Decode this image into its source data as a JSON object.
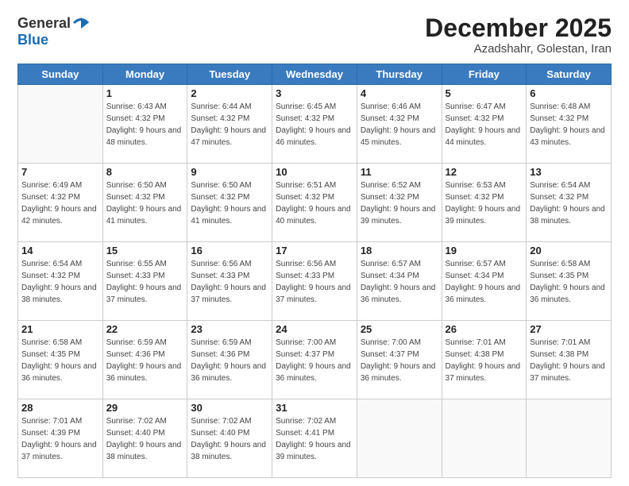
{
  "logo": {
    "general": "General",
    "blue": "Blue"
  },
  "title": {
    "month": "December 2025",
    "location": "Azadshahr, Golestan, Iran"
  },
  "weekdays": [
    "Sunday",
    "Monday",
    "Tuesday",
    "Wednesday",
    "Thursday",
    "Friday",
    "Saturday"
  ],
  "weeks": [
    [
      {
        "day": "",
        "sunrise": "",
        "sunset": "",
        "daylight": ""
      },
      {
        "day": "1",
        "sunrise": "Sunrise: 6:43 AM",
        "sunset": "Sunset: 4:32 PM",
        "daylight": "Daylight: 9 hours and 48 minutes."
      },
      {
        "day": "2",
        "sunrise": "Sunrise: 6:44 AM",
        "sunset": "Sunset: 4:32 PM",
        "daylight": "Daylight: 9 hours and 47 minutes."
      },
      {
        "day": "3",
        "sunrise": "Sunrise: 6:45 AM",
        "sunset": "Sunset: 4:32 PM",
        "daylight": "Daylight: 9 hours and 46 minutes."
      },
      {
        "day": "4",
        "sunrise": "Sunrise: 6:46 AM",
        "sunset": "Sunset: 4:32 PM",
        "daylight": "Daylight: 9 hours and 45 minutes."
      },
      {
        "day": "5",
        "sunrise": "Sunrise: 6:47 AM",
        "sunset": "Sunset: 4:32 PM",
        "daylight": "Daylight: 9 hours and 44 minutes."
      },
      {
        "day": "6",
        "sunrise": "Sunrise: 6:48 AM",
        "sunset": "Sunset: 4:32 PM",
        "daylight": "Daylight: 9 hours and 43 minutes."
      }
    ],
    [
      {
        "day": "7",
        "sunrise": "Sunrise: 6:49 AM",
        "sunset": "Sunset: 4:32 PM",
        "daylight": "Daylight: 9 hours and 42 minutes."
      },
      {
        "day": "8",
        "sunrise": "Sunrise: 6:50 AM",
        "sunset": "Sunset: 4:32 PM",
        "daylight": "Daylight: 9 hours and 41 minutes."
      },
      {
        "day": "9",
        "sunrise": "Sunrise: 6:50 AM",
        "sunset": "Sunset: 4:32 PM",
        "daylight": "Daylight: 9 hours and 41 minutes."
      },
      {
        "day": "10",
        "sunrise": "Sunrise: 6:51 AM",
        "sunset": "Sunset: 4:32 PM",
        "daylight": "Daylight: 9 hours and 40 minutes."
      },
      {
        "day": "11",
        "sunrise": "Sunrise: 6:52 AM",
        "sunset": "Sunset: 4:32 PM",
        "daylight": "Daylight: 9 hours and 39 minutes."
      },
      {
        "day": "12",
        "sunrise": "Sunrise: 6:53 AM",
        "sunset": "Sunset: 4:32 PM",
        "daylight": "Daylight: 9 hours and 39 minutes."
      },
      {
        "day": "13",
        "sunrise": "Sunrise: 6:54 AM",
        "sunset": "Sunset: 4:32 PM",
        "daylight": "Daylight: 9 hours and 38 minutes."
      }
    ],
    [
      {
        "day": "14",
        "sunrise": "Sunrise: 6:54 AM",
        "sunset": "Sunset: 4:32 PM",
        "daylight": "Daylight: 9 hours and 38 minutes."
      },
      {
        "day": "15",
        "sunrise": "Sunrise: 6:55 AM",
        "sunset": "Sunset: 4:33 PM",
        "daylight": "Daylight: 9 hours and 37 minutes."
      },
      {
        "day": "16",
        "sunrise": "Sunrise: 6:56 AM",
        "sunset": "Sunset: 4:33 PM",
        "daylight": "Daylight: 9 hours and 37 minutes."
      },
      {
        "day": "17",
        "sunrise": "Sunrise: 6:56 AM",
        "sunset": "Sunset: 4:33 PM",
        "daylight": "Daylight: 9 hours and 37 minutes."
      },
      {
        "day": "18",
        "sunrise": "Sunrise: 6:57 AM",
        "sunset": "Sunset: 4:34 PM",
        "daylight": "Daylight: 9 hours and 36 minutes."
      },
      {
        "day": "19",
        "sunrise": "Sunrise: 6:57 AM",
        "sunset": "Sunset: 4:34 PM",
        "daylight": "Daylight: 9 hours and 36 minutes."
      },
      {
        "day": "20",
        "sunrise": "Sunrise: 6:58 AM",
        "sunset": "Sunset: 4:35 PM",
        "daylight": "Daylight: 9 hours and 36 minutes."
      }
    ],
    [
      {
        "day": "21",
        "sunrise": "Sunrise: 6:58 AM",
        "sunset": "Sunset: 4:35 PM",
        "daylight": "Daylight: 9 hours and 36 minutes."
      },
      {
        "day": "22",
        "sunrise": "Sunrise: 6:59 AM",
        "sunset": "Sunset: 4:36 PM",
        "daylight": "Daylight: 9 hours and 36 minutes."
      },
      {
        "day": "23",
        "sunrise": "Sunrise: 6:59 AM",
        "sunset": "Sunset: 4:36 PM",
        "daylight": "Daylight: 9 hours and 36 minutes."
      },
      {
        "day": "24",
        "sunrise": "Sunrise: 7:00 AM",
        "sunset": "Sunset: 4:37 PM",
        "daylight": "Daylight: 9 hours and 36 minutes."
      },
      {
        "day": "25",
        "sunrise": "Sunrise: 7:00 AM",
        "sunset": "Sunset: 4:37 PM",
        "daylight": "Daylight: 9 hours and 36 minutes."
      },
      {
        "day": "26",
        "sunrise": "Sunrise: 7:01 AM",
        "sunset": "Sunset: 4:38 PM",
        "daylight": "Daylight: 9 hours and 37 minutes."
      },
      {
        "day": "27",
        "sunrise": "Sunrise: 7:01 AM",
        "sunset": "Sunset: 4:38 PM",
        "daylight": "Daylight: 9 hours and 37 minutes."
      }
    ],
    [
      {
        "day": "28",
        "sunrise": "Sunrise: 7:01 AM",
        "sunset": "Sunset: 4:39 PM",
        "daylight": "Daylight: 9 hours and 37 minutes."
      },
      {
        "day": "29",
        "sunrise": "Sunrise: 7:02 AM",
        "sunset": "Sunset: 4:40 PM",
        "daylight": "Daylight: 9 hours and 38 minutes."
      },
      {
        "day": "30",
        "sunrise": "Sunrise: 7:02 AM",
        "sunset": "Sunset: 4:40 PM",
        "daylight": "Daylight: 9 hours and 38 minutes."
      },
      {
        "day": "31",
        "sunrise": "Sunrise: 7:02 AM",
        "sunset": "Sunset: 4:41 PM",
        "daylight": "Daylight: 9 hours and 39 minutes."
      },
      {
        "day": "",
        "sunrise": "",
        "sunset": "",
        "daylight": ""
      },
      {
        "day": "",
        "sunrise": "",
        "sunset": "",
        "daylight": ""
      },
      {
        "day": "",
        "sunrise": "",
        "sunset": "",
        "daylight": ""
      }
    ]
  ]
}
